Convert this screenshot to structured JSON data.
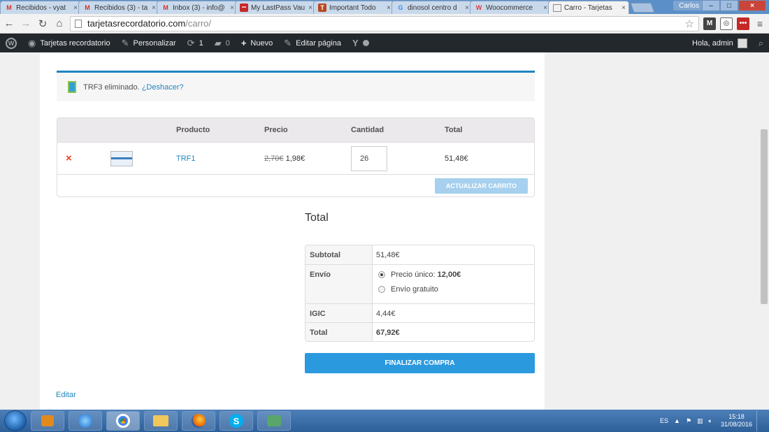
{
  "browser": {
    "tabs": [
      {
        "label": "Recibidos - vyat",
        "favicon": "gmail-icon",
        "favicon_text": "M",
        "active": false
      },
      {
        "label": "Recibidos (3) - ta",
        "favicon": "gmail-icon",
        "favicon_text": "M",
        "active": false
      },
      {
        "label": "Inbox (3) - info@",
        "favicon": "gmail-icon",
        "favicon_text": "M",
        "active": false
      },
      {
        "label": "My LastPass Vau",
        "favicon": "lastpass-icon",
        "favicon_text": "•••",
        "active": false
      },
      {
        "label": "Important Todo",
        "favicon": "trello-icon",
        "favicon_text": "T",
        "active": false
      },
      {
        "label": "dinosol centro d",
        "favicon": "google-icon",
        "favicon_text": "G",
        "active": false
      },
      {
        "label": "Woocommerce",
        "favicon": "woocommerce-icon",
        "favicon_text": "W",
        "active": false
      },
      {
        "label": "Carro - Tarjetas",
        "favicon": "page-icon",
        "favicon_text": "",
        "active": true
      }
    ],
    "window_user": "Carlos",
    "url_host": "tarjetasrecordatorio.com",
    "url_path": "/carro/"
  },
  "adminbar": {
    "site_name": "Tarjetas recordatorio",
    "customize": "Personalizar",
    "updates_count": "1",
    "comments_count": "0",
    "new_label": "Nuevo",
    "edit_page": "Editar página",
    "greeting": "Hola, admin"
  },
  "notice": {
    "message": "TRF3 eliminado.",
    "undo": "¿Deshacer?"
  },
  "cart": {
    "headers": {
      "product": "Producto",
      "price": "Precio",
      "quantity": "Cantidad",
      "total": "Total"
    },
    "rows": [
      {
        "name": "TRF1",
        "old_price": "2,70€",
        "price": "1,98€",
        "quantity": "26",
        "total": "51,48€"
      }
    ],
    "update_button": "ACTUALIZAR CARRITO"
  },
  "totals": {
    "title": "Total",
    "subtotal_label": "Subtotal",
    "subtotal": "51,48€",
    "shipping_label": "Envío",
    "shipping_options": [
      {
        "label": "Precio único:",
        "amount": "12,00€",
        "selected": true
      },
      {
        "label": "Envío gratuito",
        "amount": "",
        "selected": false
      }
    ],
    "tax_label": "IGIC",
    "tax": "4,44€",
    "total_label": "Total",
    "total": "67,92€",
    "checkout_button": "FINALIZAR COMPRA"
  },
  "edit_link": "Editar",
  "taskbar": {
    "language": "ES",
    "time": "15:18",
    "date": "31/08/2016"
  },
  "colors": {
    "accent_blue": "#1e85be",
    "checkout_blue": "#2b99de",
    "remove_red": "#e2401c",
    "adminbar_bg": "#23282d"
  }
}
